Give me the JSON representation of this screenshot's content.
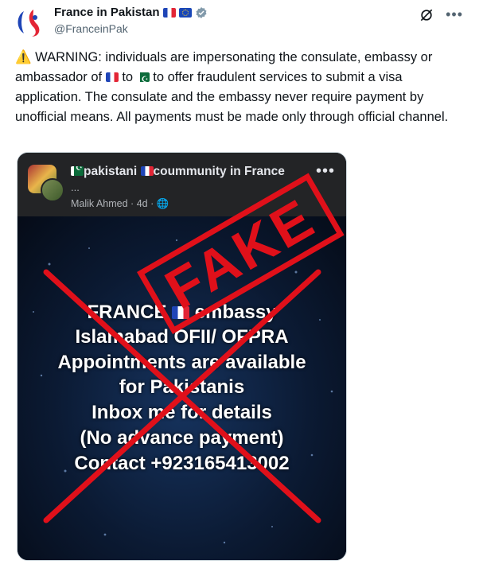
{
  "account": {
    "name": "France in Pakistan",
    "handle": "@FranceinPak",
    "verified": true
  },
  "tweet": {
    "warning_icon": "⚠️",
    "text_part1": " WARNING: individuals are impersonating the consulate, embassy or ambassador of ",
    "text_part2": " to ",
    "text_part3": " to offer fraudulent services to submit a visa application. The consulate and the embassy never require payment by unofficial means. All payments must be made only through official channel."
  },
  "embedded_post": {
    "group_name_part1": "pakistani ",
    "group_name_part2": "coummunity in France",
    "dots": "...",
    "poster": "Malik Ahmed",
    "age": "4d",
    "stamp": "FAKE",
    "lines": [
      "FRANCE",
      "embassy",
      "Islamabad OFII/ OFPRA",
      "Appointments are available",
      "for Pakistanis",
      "Inbox me for details",
      "(No advance payment)",
      "Contact +923165413002"
    ]
  },
  "colors": {
    "stamp_red": "#e0101a",
    "secondary_text": "#536471"
  },
  "icons": [
    "edit-slash-icon",
    "more-icon",
    "verified-icon",
    "globe-icon",
    "warning-icon"
  ]
}
